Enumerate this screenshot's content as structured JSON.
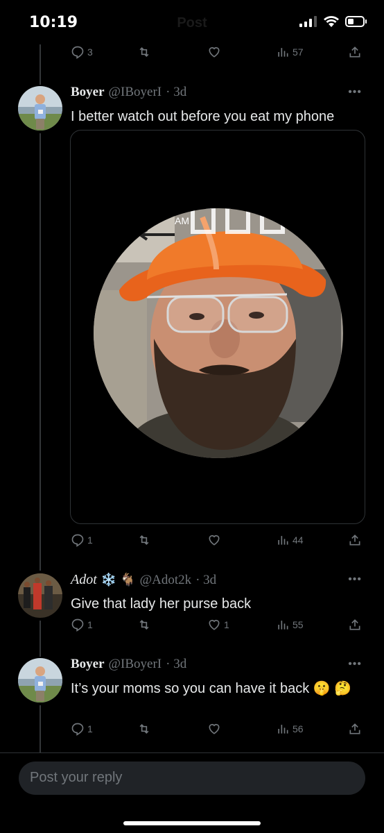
{
  "status": {
    "time": "10:19"
  },
  "header": {
    "title": "Post"
  },
  "top_actions": {
    "replies": "3",
    "retweets": "",
    "likes": "",
    "views": "57"
  },
  "tweets": [
    {
      "name": "Boyer",
      "handle": "@IBoyerI",
      "time": "· 3d",
      "text": "I better watch out before you eat my phone",
      "actions": {
        "replies": "1",
        "retweets": "",
        "likes": "",
        "views": "44"
      },
      "media_overlay_text": "AM"
    },
    {
      "name": "Adot",
      "name_emoji": "❄️ 🐐",
      "handle": "@Adot2k",
      "time": "· 3d",
      "text": "Give that lady her purse back",
      "actions": {
        "replies": "1",
        "retweets": "",
        "likes": "1",
        "views": "55"
      }
    },
    {
      "name": "Boyer",
      "handle": "@IBoyerI",
      "time": "· 3d",
      "text": "It’s your moms so you can have it back 🤫 🤔",
      "actions": {
        "replies": "1",
        "retweets": "",
        "likes": "",
        "views": "56"
      }
    }
  ],
  "reply_bar": {
    "placeholder": "Post your reply"
  },
  "colors": {
    "background": "#000000",
    "text": "#e7e9ea",
    "muted": "#71767b",
    "hardhat": "#e8631c"
  }
}
